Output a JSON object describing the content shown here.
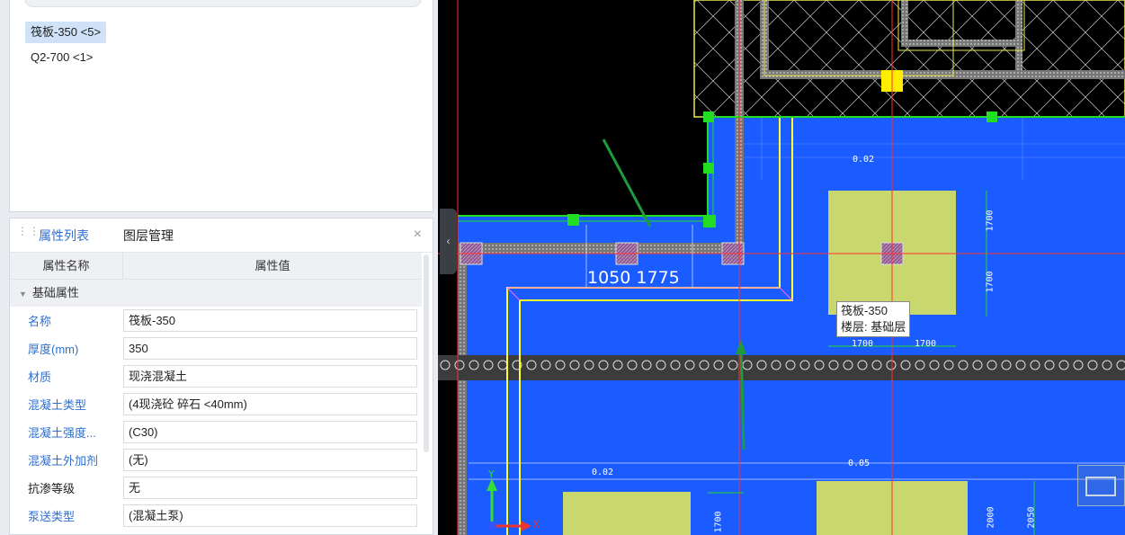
{
  "component_list": {
    "items": [
      {
        "label": "筏板-350 <5>",
        "selected": true
      },
      {
        "label": "Q2-700 <1>",
        "selected": false
      }
    ]
  },
  "property_panel": {
    "tabs": [
      {
        "label": "属性列表",
        "active": true
      },
      {
        "label": "图层管理",
        "active": false
      }
    ],
    "close_icon": "×",
    "columns": {
      "name": "属性名称",
      "value": "属性值"
    },
    "group": "基础属性",
    "rows": [
      {
        "name": "名称",
        "value": "筏板-350"
      },
      {
        "name": "厚度(mm)",
        "value": "350"
      },
      {
        "name": "材质",
        "value": "现浇混凝土"
      },
      {
        "name": "混凝土类型",
        "value": "(4现浇砼 碎石 <40mm)"
      },
      {
        "name": "混凝土强度...",
        "value": "(C30)"
      },
      {
        "name": "混凝土外加剂",
        "value": "(无)"
      },
      {
        "name": "抗渗等级",
        "value": "无"
      },
      {
        "name": "泵送类型",
        "value": "(混凝土泵)"
      }
    ]
  },
  "viewport": {
    "dimension_text": "1050 1775",
    "tooltip": {
      "line1": "筏板-350",
      "line2": "楼层: 基础层"
    },
    "small_dims": {
      "d1": "1700",
      "d2": "1700",
      "d3": "1700",
      "d4": "1700",
      "d5": "1700",
      "d6": "2000",
      "d7": "2050",
      "elev1": "0.02",
      "elev2": "0.02",
      "elev3": "0.05"
    },
    "axis_labels": {
      "x": "X",
      "y": "Y"
    },
    "colors": {
      "background": "#000000",
      "slab": "#1a5cff",
      "column": "#c8d86e",
      "selection": "#22dd22",
      "edge": "#ffff33"
    }
  }
}
